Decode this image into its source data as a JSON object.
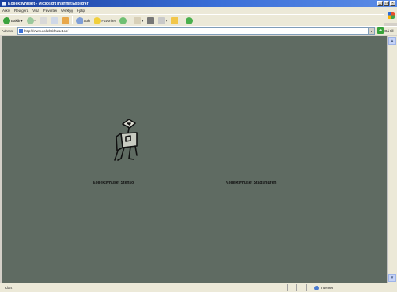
{
  "window": {
    "title": "Kollektivhuset - Microsoft Internet Explorer",
    "controls": [
      "_",
      "□",
      "×"
    ]
  },
  "menu": {
    "items": [
      "Arkiv",
      "Redigera",
      "Visa",
      "Favoriter",
      "Verktyg",
      "Hjälp"
    ]
  },
  "toolbar": {
    "back_label": "Bakåt",
    "search_label": "Sök",
    "favorites_label": "Favoriter",
    "icons": [
      "back-arrow-icon",
      "forward-arrow-icon",
      "stop-icon",
      "refresh-icon",
      "home-icon",
      "search-icon",
      "favorites-star-icon",
      "history-icon",
      "mail-icon",
      "print-icon",
      "edit-icon",
      "folder-icon",
      "messenger-icon"
    ]
  },
  "address": {
    "label": "Adress",
    "url": "http://www.kollektivhuset.se/",
    "go_label": "Gå till"
  },
  "content": {
    "background": "#5f6b62",
    "link_left": "Kollektivhuset Stensö",
    "link_right": "Kollektivhuset Stadsmuren"
  },
  "status": {
    "text": "Klart",
    "zone": "Internet"
  }
}
